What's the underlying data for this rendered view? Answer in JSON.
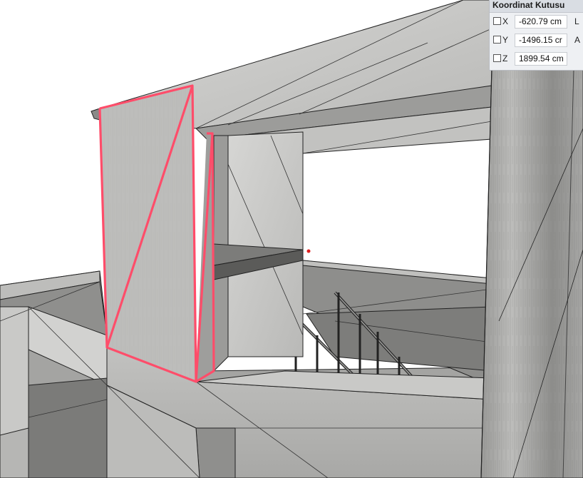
{
  "coordinate_box": {
    "title": "Koordinat Kutusu",
    "rows": [
      {
        "axis": "X",
        "value": "-620.79 cm",
        "suffix": "L",
        "checked": false
      },
      {
        "axis": "Y",
        "value": "-1496.15 cr",
        "suffix": "A",
        "checked": false
      },
      {
        "axis": "Z",
        "value": "1899.54 cm",
        "suffix": "",
        "checked": false
      }
    ]
  },
  "colors": {
    "selection_edge": "#ff4d6a",
    "concrete": "#c9c9c7",
    "shadow": "#7a7a7a",
    "cursor_dot": "#e02020"
  },
  "icons": {
    "cursor": "cursor-point-icon"
  }
}
